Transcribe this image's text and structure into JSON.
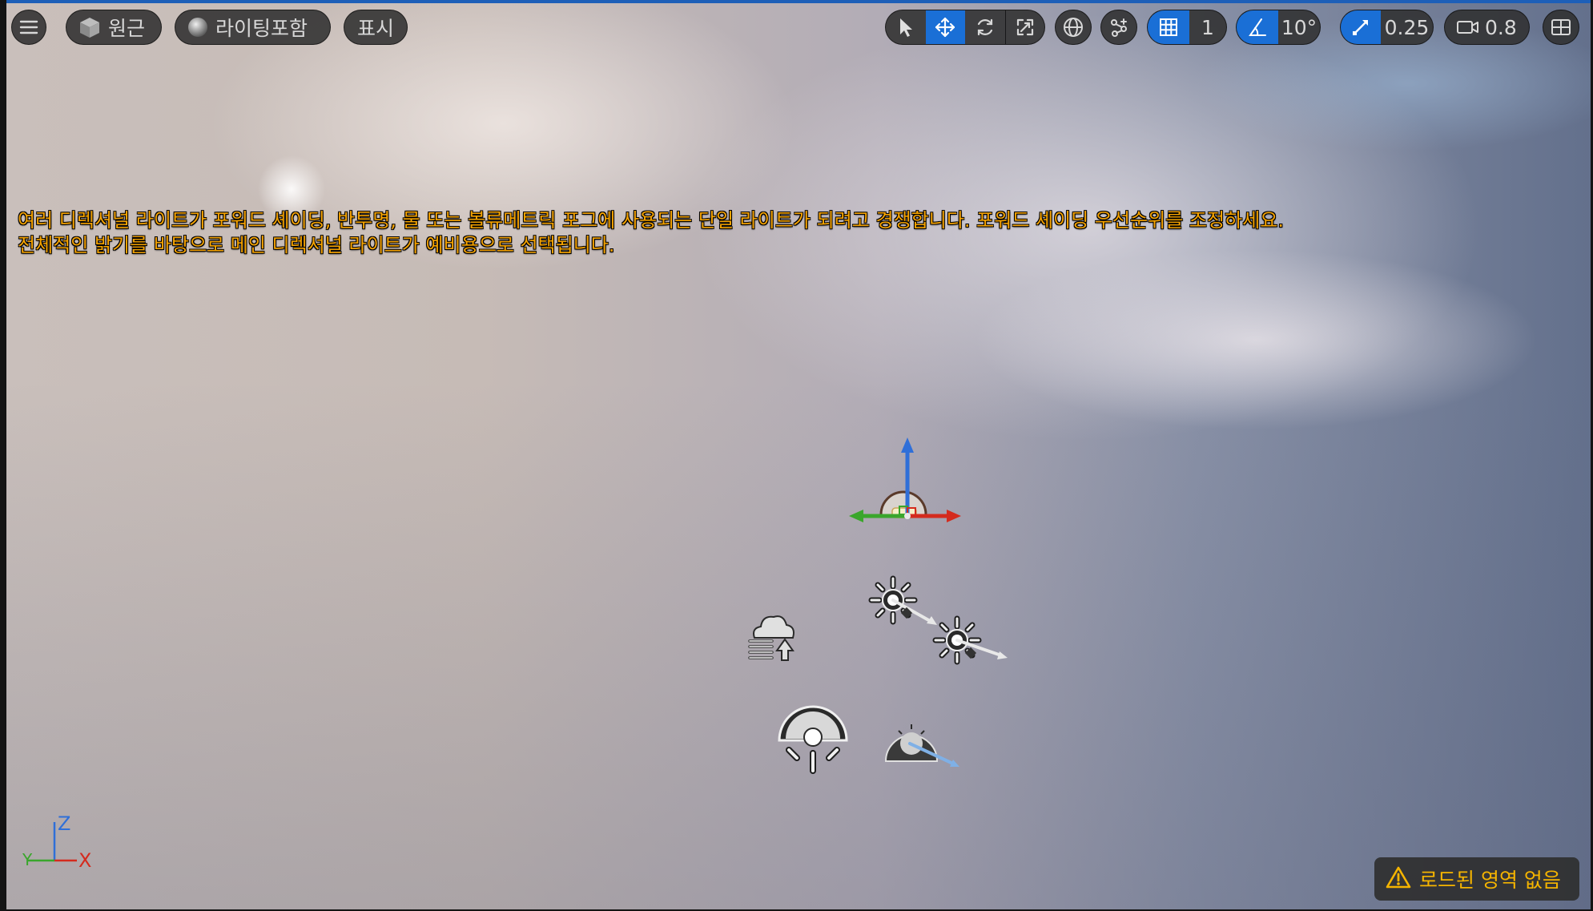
{
  "toolbar": {
    "left": {
      "menu_icon": "hamburger-icon",
      "view_mode_label": "원근",
      "view_mode_icon": "cube-icon",
      "lighting_label": "라이팅포함",
      "lighting_icon": "sphere-icon",
      "show_label": "표시"
    },
    "transform": {
      "select_icon": "cursor-icon",
      "translate_icon": "move-icon",
      "rotate_icon": "rotate-icon",
      "scale_icon": "scale-icon",
      "active_tool": "translate"
    },
    "world_local_icon": "globe-icon",
    "surface_snap_icon": "surface-snap-icon",
    "grid_snap_value": "1",
    "rotation_snap_value": "10°",
    "scale_snap_value": "0.25",
    "camera_speed_value": "0.8",
    "layout_icon": "viewport-layout-icon"
  },
  "warning_message": {
    "line1": "여러 디렉셔널 라이트가 포워드 셰이딩, 반투명, 물 또는 볼류메트릭 포그에 사용되는 단일 라이트가 되려고 경쟁합니다. 포워드 셰이딩 우선순위를 조정하세요.",
    "line2": "전체적인 밝기를 바탕으로 메인 디렉셔널 라이트가 예비용으로 선택됩니다."
  },
  "axis_indicator": {
    "z": "Z",
    "y": "Y",
    "x": "X"
  },
  "status": {
    "no_regions_loaded": "로드된 영역 없음"
  },
  "colors": {
    "accent": "#1a6fd6",
    "warning": "#f5a300",
    "axis_x": "#d42b1e",
    "axis_y": "#3aa62c",
    "axis_z": "#2f6fd8"
  }
}
